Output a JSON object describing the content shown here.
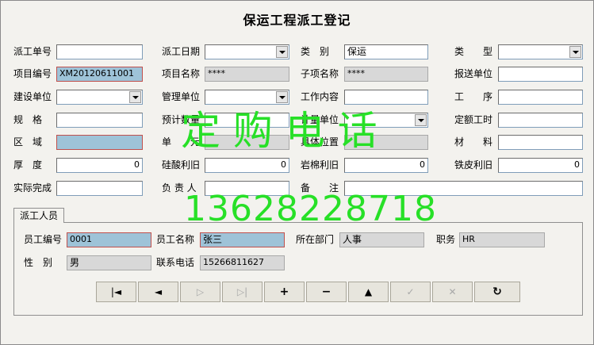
{
  "title": "保运工程派工登记",
  "watermark": {
    "line1": "定 购 电 话",
    "line2": "13628228718",
    "color": "#27e027"
  },
  "form": {
    "dispatch_no": {
      "label": "派工单号",
      "value": ""
    },
    "dispatch_date": {
      "label": "派工日期",
      "value": ""
    },
    "category": {
      "label": "类　别",
      "value": "保运"
    },
    "type": {
      "label": "类　　型",
      "value": ""
    },
    "project_no": {
      "label": "项目编号",
      "value": "XM20120611001"
    },
    "project_name": {
      "label": "项目名称",
      "value": "****"
    },
    "subitem_name": {
      "label": "子项名称",
      "value": "****"
    },
    "report_unit": {
      "label": "报送单位",
      "value": ""
    },
    "build_unit": {
      "label": "建设单位",
      "value": ""
    },
    "manage_unit": {
      "label": "管理单位",
      "value": ""
    },
    "work_content": {
      "label": "工作内容",
      "value": ""
    },
    "process": {
      "label": "工　　序",
      "value": ""
    },
    "spec": {
      "label": "规　格",
      "value": ""
    },
    "est_qty": {
      "label": "预计数量",
      "value": ""
    },
    "measure_unit": {
      "label": "计量单位",
      "value": ""
    },
    "quota_hours": {
      "label": "定额工时",
      "value": ""
    },
    "area": {
      "label": "区　域",
      "value": ""
    },
    "unit": {
      "label": "单　　元",
      "value": ""
    },
    "location": {
      "label": "具体位置",
      "value": ""
    },
    "material": {
      "label": "材　　料",
      "value": ""
    },
    "thickness": {
      "label": "厚　度",
      "value": "0"
    },
    "silicate_reuse": {
      "label": "硅酸利旧",
      "value": "0"
    },
    "rockwool_reuse": {
      "label": "岩棉利旧",
      "value": "0"
    },
    "iron_reuse": {
      "label": "铁皮利旧",
      "value": "0"
    },
    "actual_done": {
      "label": "实际完成",
      "value": ""
    },
    "person_in_charge": {
      "label": "负 责 人",
      "value": ""
    },
    "remark": {
      "label": "备　　注",
      "value": ""
    }
  },
  "tab": {
    "label": "派工人员"
  },
  "staff": {
    "emp_no": {
      "label": "员工编号",
      "value": "0001"
    },
    "emp_name": {
      "label": "员工名称",
      "value": "张三"
    },
    "dept": {
      "label": "所在部门",
      "value": "人事"
    },
    "position": {
      "label": "职务",
      "value": "HR"
    },
    "gender": {
      "label": "性　别",
      "value": "男"
    },
    "phone": {
      "label": "联系电话",
      "value": "15266811627"
    }
  },
  "navigator": [
    {
      "name": "first",
      "glyph": "|◄",
      "enabled": true
    },
    {
      "name": "prior",
      "glyph": "◄",
      "enabled": true
    },
    {
      "name": "next",
      "glyph": "▷",
      "enabled": false
    },
    {
      "name": "last",
      "glyph": "▷|",
      "enabled": false
    },
    {
      "name": "insert",
      "glyph": "+",
      "enabled": true
    },
    {
      "name": "delete",
      "glyph": "−",
      "enabled": true
    },
    {
      "name": "edit",
      "glyph": "▲",
      "enabled": true
    },
    {
      "name": "post",
      "glyph": "✓",
      "enabled": false
    },
    {
      "name": "cancel",
      "glyph": "✕",
      "enabled": false
    },
    {
      "name": "refresh",
      "glyph": "↻",
      "enabled": true
    }
  ]
}
